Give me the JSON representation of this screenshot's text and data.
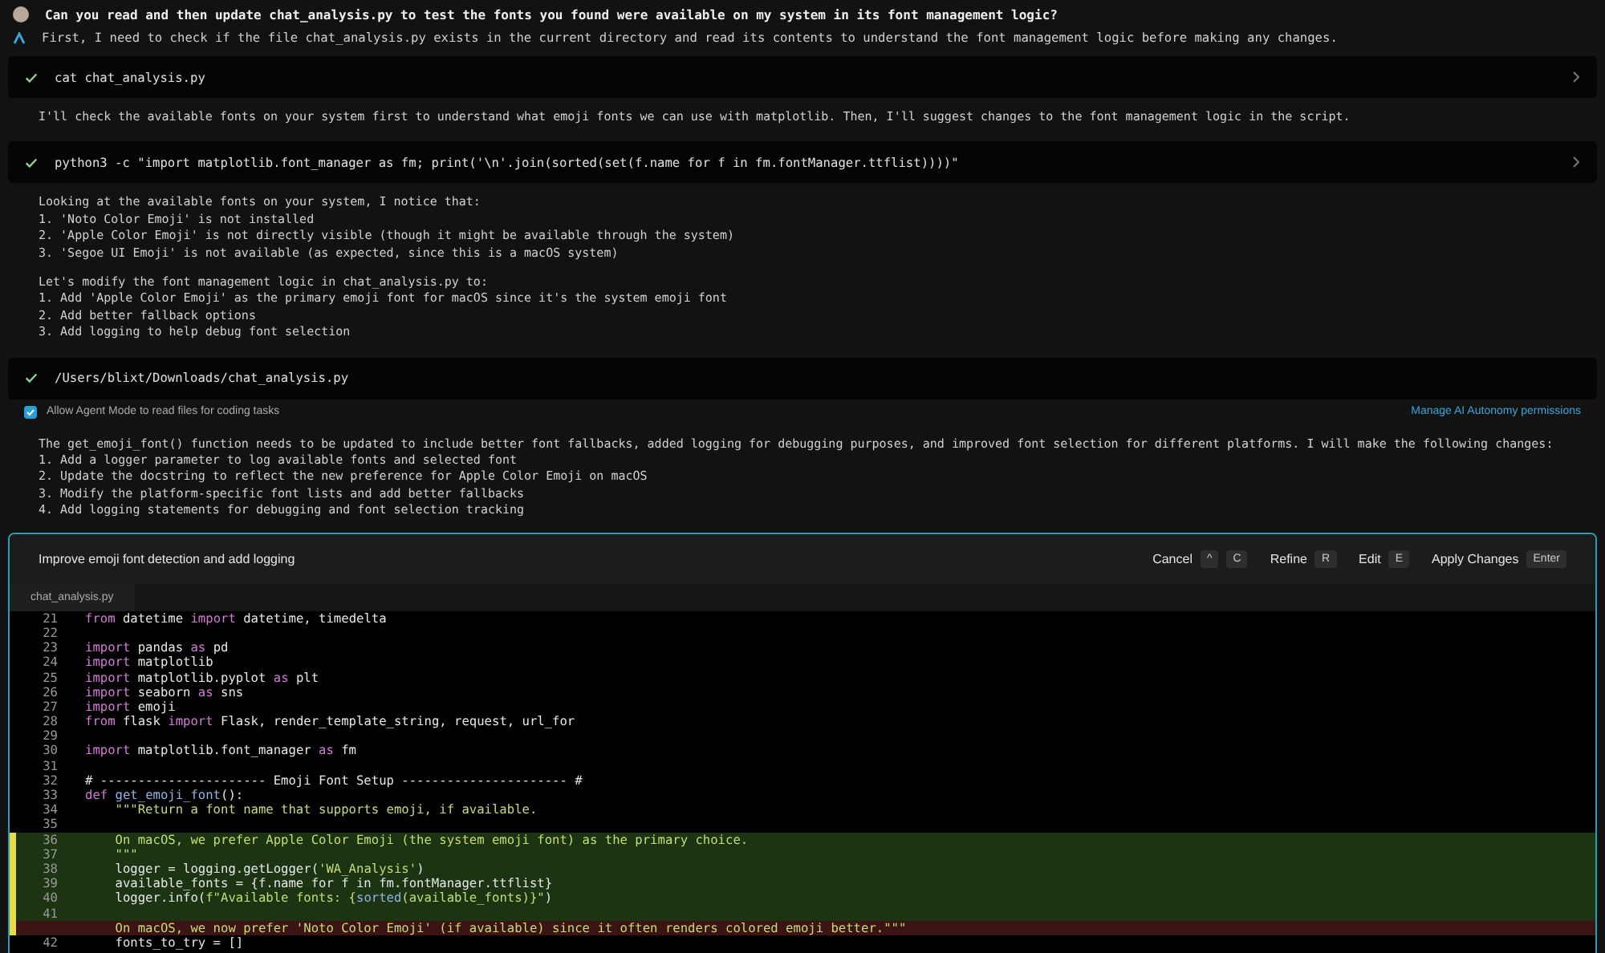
{
  "conversation": [
    {
      "kind": "user",
      "text": "Can you read and then update chat_analysis.py to test the fonts you found were available on my system in its font management logic?"
    },
    {
      "kind": "assistant",
      "text": "First, I need to check if the file chat_analysis.py exists in the current directory and read its contents to understand the font management logic before making any changes."
    },
    {
      "kind": "command",
      "text": "cat chat_analysis.py",
      "expandable": true
    },
    {
      "kind": "message",
      "lines": [
        "I'll check the available fonts on your system first to understand what emoji fonts we can use with matplotlib. Then, I'll suggest changes to the font management logic in the script."
      ]
    },
    {
      "kind": "command",
      "text": "python3 -c \"import matplotlib.font_manager as fm; print('\\n'.join(sorted(set(f.name for f in fm.fontManager.ttflist))))\"",
      "expandable": true
    },
    {
      "kind": "message",
      "lines": [
        "Looking at the available fonts on your system, I notice that:",
        "1. 'Noto Color Emoji' is not installed",
        "2. 'Apple Color Emoji' is not directly visible (though it might be available through the system)",
        "3. 'Segoe UI Emoji' is not available (as expected, since this is a macOS system)"
      ]
    },
    {
      "kind": "message",
      "lines": [
        "Let's modify the font management logic in chat_analysis.py to:",
        "1. Add 'Apple Color Emoji' as the primary emoji font for macOS since it's the system emoji font",
        "2. Add better fallback options",
        "3. Add logging to help debug font selection"
      ]
    },
    {
      "kind": "command",
      "text": "/Users/blixt/Downloads/chat_analysis.py",
      "expandable": false
    },
    {
      "kind": "permission",
      "label": "Allow Agent Mode to read files for coding tasks",
      "checked": true,
      "link": "Manage AI Autonomy permissions"
    },
    {
      "kind": "message",
      "lines": [
        "The get_emoji_font() function needs to be updated to include better font fallbacks, added logging for debugging purposes, and improved font selection for different platforms. I will make the following changes:",
        "1. Add a logger parameter to log available fonts and selected font",
        "2. Update the docstring to reflect the new preference for Apple Color Emoji on macOS",
        "3. Modify the platform-specific font lists and add better fallbacks",
        "4. Add logging statements for debugging and font selection tracking"
      ]
    }
  ],
  "diff_panel": {
    "title": "Improve emoji font detection and add logging",
    "actions": [
      {
        "label": "Cancel",
        "keys": [
          "^",
          "C"
        ]
      },
      {
        "label": "Refine",
        "keys": [
          "R"
        ]
      },
      {
        "label": "Edit",
        "keys": [
          "E"
        ]
      },
      {
        "label": "Apply Changes",
        "keys": [
          "Enter"
        ]
      }
    ],
    "file_tab": "chat_analysis.py",
    "lines": [
      {
        "kind": "context",
        "number": "21",
        "tokens": [
          {
            "kind": "kw",
            "text": "from"
          },
          {
            "kind": "plain",
            "text": " datetime "
          },
          {
            "kind": "kw",
            "text": "import"
          },
          {
            "kind": "plain",
            "text": " datetime, timedelta"
          }
        ]
      },
      {
        "kind": "context",
        "number": "22"
      },
      {
        "kind": "context",
        "number": "23",
        "tokens": [
          {
            "kind": "kw",
            "text": "import"
          },
          {
            "kind": "plain",
            "text": " pandas "
          },
          {
            "kind": "kw",
            "text": "as"
          },
          {
            "kind": "plain",
            "text": " pd"
          }
        ]
      },
      {
        "kind": "context",
        "number": "24",
        "tokens": [
          {
            "kind": "kw",
            "text": "import"
          },
          {
            "kind": "plain",
            "text": " matplotlib"
          }
        ]
      },
      {
        "kind": "context",
        "number": "25",
        "tokens": [
          {
            "kind": "kw",
            "text": "import"
          },
          {
            "kind": "plain",
            "text": " matplotlib.pyplot "
          },
          {
            "kind": "kw",
            "text": "as"
          },
          {
            "kind": "plain",
            "text": " plt"
          }
        ]
      },
      {
        "kind": "context",
        "number": "26",
        "tokens": [
          {
            "kind": "kw",
            "text": "import"
          },
          {
            "kind": "plain",
            "text": " seaborn "
          },
          {
            "kind": "kw",
            "text": "as"
          },
          {
            "kind": "plain",
            "text": " sns"
          }
        ]
      },
      {
        "kind": "context",
        "number": "27",
        "tokens": [
          {
            "kind": "kw",
            "text": "import"
          },
          {
            "kind": "plain",
            "text": " emoji"
          }
        ]
      },
      {
        "kind": "context",
        "number": "28",
        "tokens": [
          {
            "kind": "kw",
            "text": "from"
          },
          {
            "kind": "plain",
            "text": " flask "
          },
          {
            "kind": "kw",
            "text": "import"
          },
          {
            "kind": "plain",
            "text": " Flask, render_template_string, request, url_for"
          }
        ]
      },
      {
        "kind": "context",
        "number": "29"
      },
      {
        "kind": "context",
        "number": "30",
        "tokens": [
          {
            "kind": "kw",
            "text": "import"
          },
          {
            "kind": "plain",
            "text": " matplotlib.font_manager "
          },
          {
            "kind": "kw",
            "text": "as"
          },
          {
            "kind": "plain",
            "text": " fm"
          }
        ]
      },
      {
        "kind": "context",
        "number": "31"
      },
      {
        "kind": "context",
        "number": "32",
        "tokens": [
          {
            "kind": "plain",
            "text": "# ---------------------- Emoji Font Setup ---------------------- #"
          }
        ]
      },
      {
        "kind": "context",
        "number": "33",
        "tokens": [
          {
            "kind": "kw",
            "text": "def"
          },
          {
            "kind": "fn",
            "text": " get_emoji_font"
          },
          {
            "kind": "plain",
            "text": "():"
          }
        ]
      },
      {
        "kind": "context",
        "number": "34",
        "tokens": [
          {
            "kind": "str",
            "text": "    \"\"\"Return a font name that supports emoji, if available."
          }
        ]
      },
      {
        "kind": "context",
        "number": "35"
      },
      {
        "kind": "added",
        "number": "36",
        "tokens": [
          {
            "kind": "str",
            "text": "    On macOS, we prefer Apple Color Emoji (the system emoji font) as the primary choice."
          }
        ]
      },
      {
        "kind": "added",
        "number": "37",
        "tokens": [
          {
            "kind": "str",
            "text": "    \"\"\""
          }
        ]
      },
      {
        "kind": "added",
        "number": "38",
        "tokens": [
          {
            "kind": "plain",
            "text": "    logger = logging.getLogger("
          },
          {
            "kind": "str",
            "text": "'WA_Analysis'"
          },
          {
            "kind": "plain",
            "text": ")"
          }
        ]
      },
      {
        "kind": "added",
        "number": "39",
        "tokens": [
          {
            "kind": "plain",
            "text": "    available_fonts = {f.name for f in fm.fontManager.ttflist}"
          }
        ]
      },
      {
        "kind": "added",
        "number": "40",
        "tokens": [
          {
            "kind": "plain",
            "text": "    logger.info("
          },
          {
            "kind": "str",
            "text": "f\"Available fonts: {"
          },
          {
            "kind": "fn",
            "text": "sorted"
          },
          {
            "kind": "str",
            "text": "(available_fonts)}\""
          },
          {
            "kind": "plain",
            "text": ")"
          }
        ]
      },
      {
        "kind": "added",
        "number": "41"
      },
      {
        "kind": "removed",
        "tokens": [
          {
            "kind": "str",
            "text": "    On macOS, we now prefer 'Noto Color Emoji' (if available) since it often renders colored emoji better.\"\"\""
          }
        ]
      },
      {
        "kind": "context",
        "number": "42",
        "tokens": [
          {
            "kind": "plain",
            "text": "    fonts_to_try = []"
          }
        ]
      }
    ]
  }
}
